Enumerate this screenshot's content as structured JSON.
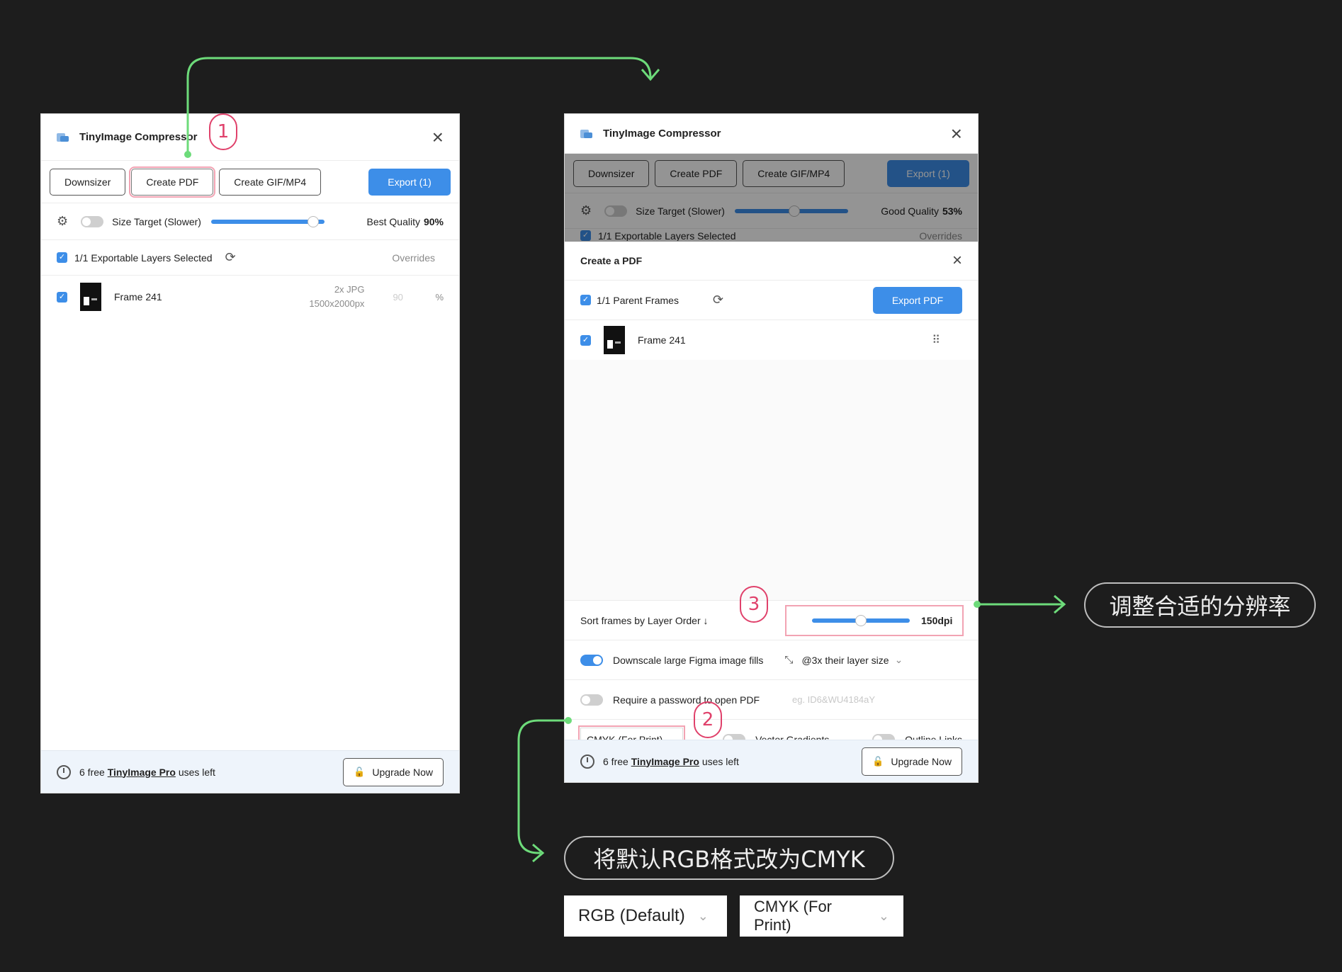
{
  "left_panel": {
    "title": "TinyImage Compressor",
    "tabs": [
      "Downsizer",
      "Create PDF",
      "Create GIF/MP4"
    ],
    "export_label": "Export (1)",
    "size_target_label": "Size Target (Slower)",
    "quality_label": "Best Quality",
    "quality_value": "90%",
    "quality_fraction": 0.9,
    "layers_selected": "1/1 Exportable Layers Selected",
    "overrides_label": "Overrides",
    "frame_name": "Frame 241",
    "frame_format": "2x JPG",
    "frame_size": "1500x2000px",
    "frame_quality": "90",
    "percent_sign": "%",
    "footer_prefix": "6 free",
    "footer_link": "TinyImage Pro",
    "footer_suffix": "uses left",
    "upgrade_label": "Upgrade Now"
  },
  "right_panel": {
    "title": "TinyImage Compressor",
    "tabs": [
      "Downsizer",
      "Create PDF",
      "Create GIF/MP4"
    ],
    "export_label": "Export (1)",
    "size_target_label": "Size Target (Slower)",
    "quality_label": "Good Quality",
    "quality_value": "53%",
    "layers_selected": "1/1 Exportable Layers Selected",
    "overrides_label": "Overrides",
    "dialog_title": "Create a PDF",
    "parent_frames": "1/1 Parent Frames",
    "export_pdf_label": "Export PDF",
    "frame_name": "Frame 241",
    "sort_label": "Sort frames by Layer Order ↓",
    "dpi_value": "150dpi",
    "downscale_label": "Downscale large Figma image fills",
    "downscale_option": "@3x their layer size",
    "password_label": "Require a password to open PDF",
    "password_placeholder": "eg. ID6&WU4184aY",
    "color_mode": "CMYK (For Print)",
    "vector_gradients_label": "Vector Gradients",
    "outline_links_label": "Outline Links",
    "footer_prefix": "6 free",
    "footer_link": "TinyImage Pro",
    "footer_suffix": "uses left",
    "upgrade_label": "Upgrade Now"
  },
  "annotations": {
    "badge_1": "1",
    "badge_2": "2",
    "badge_3": "3",
    "callout_resolution": "调整合适的分辨率",
    "callout_cmyk": "将默认RGB格式改为CMYK",
    "rgb_select": "RGB (Default)",
    "cmyk_select": "CMYK (For Print)"
  },
  "colors": {
    "accent": "#3d8ee8",
    "annotation_pink": "#e0416b",
    "arrow_green": "#6ddb7a",
    "background": "#1d1d1d"
  }
}
